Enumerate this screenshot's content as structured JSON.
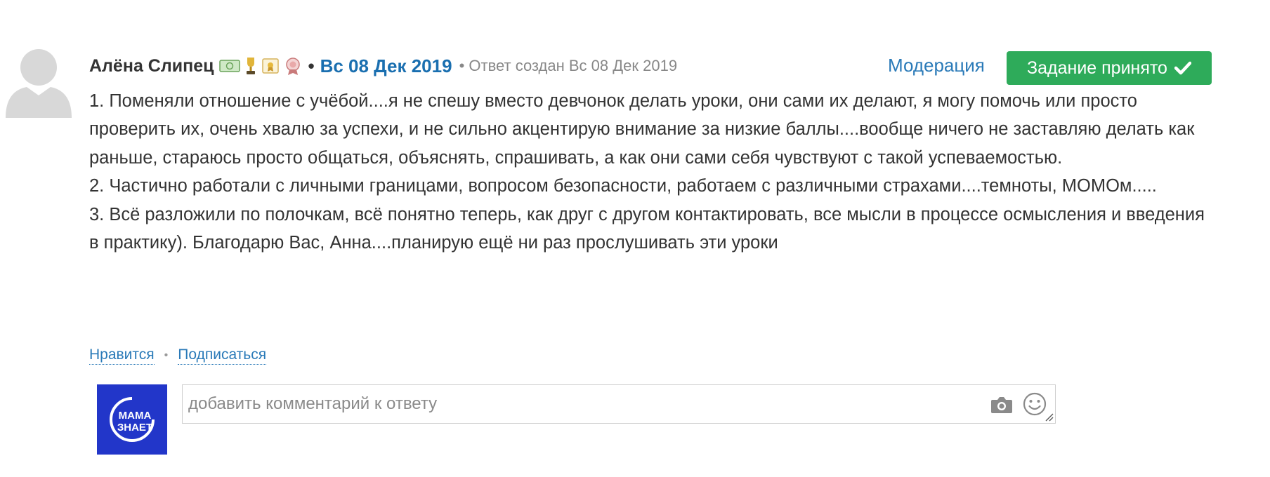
{
  "post": {
    "author": "Алёна Слипец",
    "date": "Вс 08 Дек 2019",
    "separator": "•",
    "created_meta": "• Ответ создан Вс 08 Дек 2019",
    "moderation_label": "Модерация",
    "accepted_label": "Задание принято",
    "paragraphs": [
      "1. Поменяли отношение с учёбой....я не спешу вместо девчонок делать уроки, они сами их делают, я могу помочь или просто проверить их, очень хвалю за успехи, и не сильно акцентирую внимание за низкие баллы....вообще ничего не заставляю делать как раньше, стараюсь просто общаться, объяснять, спрашивать, а как они сами себя чувствуют с такой успеваемостью.",
      "2. Частично работали с личными границами, вопросом безопасности, работаем с различными страхами....темноты, МОМОм.....",
      "3. Всё разложили по полочкам, всё понятно теперь, как друг с другом контактировать, все мысли в процессе осмысления и введения в практику). Благодарю Вас, Анна....планирую ещё ни раз прослушивать эти уроки"
    ]
  },
  "actions": {
    "like_label": "Нравится",
    "dot": "•",
    "subscribe_label": "Подписаться"
  },
  "comment": {
    "placeholder": "добавить комментарий к ответу",
    "brand_logo_text": "МАМА ЗНАЕТ"
  },
  "icons": {
    "badges": [
      "money-badge-icon",
      "trophy-badge-icon",
      "certificate-badge-icon",
      "medal-badge-icon"
    ],
    "accepted": "checkmark-icon",
    "camera": "camera-icon",
    "emoji": "smiley-icon"
  },
  "colors": {
    "link": "#2a7ab8",
    "date": "#1a6fb0",
    "accepted_button": "#2eab5a",
    "brand_avatar": "#2236c9"
  }
}
